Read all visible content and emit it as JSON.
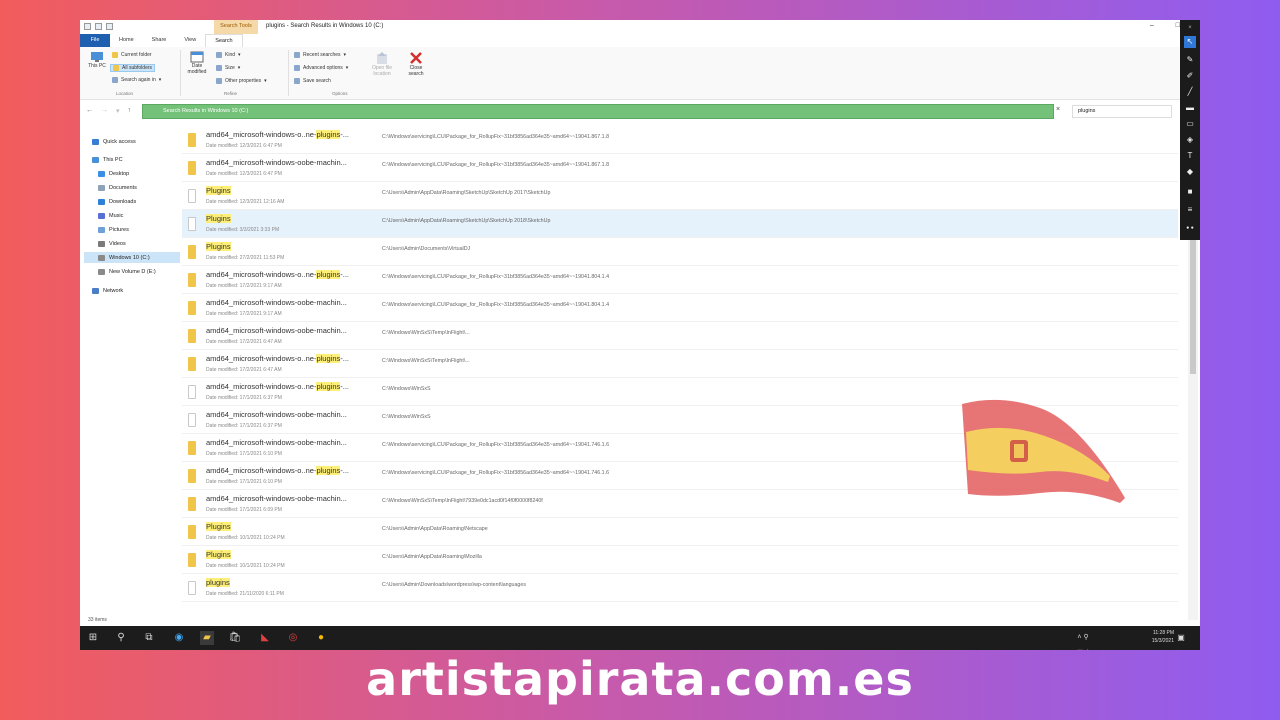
{
  "window": {
    "title": "plugins - Search Results in Windows 10 (C:)",
    "context_tab": "Search Tools"
  },
  "ribbon": {
    "tabs": [
      "File",
      "Home",
      "Share",
      "View",
      "Search"
    ],
    "location": {
      "this_pc": "This PC",
      "current_folder": "Current folder",
      "all_subfolders": "All subfolders",
      "search_again": "Search again in",
      "group": "Location"
    },
    "refine": {
      "date_modified": "Date modified",
      "kind": "Kind",
      "size": "Size",
      "other_properties": "Other properties",
      "group": "Refine"
    },
    "options": {
      "recent_searches": "Recent searches",
      "advanced_options": "Advanced options",
      "save_search": "Save search",
      "open_file_location": "Open file location",
      "close_search": "Close search",
      "group": "Options"
    }
  },
  "address": {
    "path": "Search Results in Windows 10 (C:)",
    "search_value": "plugins"
  },
  "nav": {
    "items": [
      {
        "label": "Quick access",
        "color": "#3a7bd5"
      },
      {
        "label": "This PC",
        "color": "#4a90d9"
      },
      {
        "label": "Desktop",
        "color": "#3a8ee6"
      },
      {
        "label": "Documents",
        "color": "#8fa3b8"
      },
      {
        "label": "Downloads",
        "color": "#2e7fd8"
      },
      {
        "label": "Music",
        "color": "#5a6fd6"
      },
      {
        "label": "Pictures",
        "color": "#6fa0d8"
      },
      {
        "label": "Videos",
        "color": "#7a7a7a"
      },
      {
        "label": "Windows 10 (C:)",
        "color": "#8a8a8a"
      },
      {
        "label": "New Volume D (E:)",
        "color": "#8a8a8a"
      },
      {
        "label": "Network",
        "color": "#4a7fc8"
      }
    ]
  },
  "results": [
    {
      "pre": "amd64_microsoft-windows-o..ne-",
      "hl": "plugins",
      "post": "-...",
      "date_label": "Date modified:",
      "date": "12/3/2021 6:47 PM",
      "path": "C:\\Windows\\servicing\\LCU\\Package_for_RollupFix~31bf3856ad364e35~amd64~~19041.867.1.8",
      "kind": "folder"
    },
    {
      "pre": "amd64_microsoft-windows-oobe-machin...",
      "hl": "",
      "post": "",
      "date_label": "Date modified:",
      "date": "12/3/2021 6:47 PM",
      "path": "C:\\Windows\\servicing\\LCU\\Package_for_RollupFix~31bf3856ad364e35~amd64~~19041.867.1.8",
      "kind": "folder"
    },
    {
      "pre": "",
      "hl": "Plugins",
      "post": "",
      "date_label": "Date modified:",
      "date": "12/3/2021 12:16 AM",
      "path": "C:\\Users\\Admin\\AppData\\Roaming\\SketchUp\\SketchUp 2017\\SketchUp",
      "kind": "file"
    },
    {
      "pre": "",
      "hl": "Plugins",
      "post": "",
      "date_label": "Date modified:",
      "date": "3/3/2021 3:33 PM",
      "path": "C:\\Users\\Admin\\AppData\\Roaming\\SketchUp\\SketchUp 2018\\SketchUp",
      "kind": "file"
    },
    {
      "pre": "",
      "hl": "Plugins",
      "post": "",
      "date_label": "Date modified:",
      "date": "27/2/2021 11:53 PM",
      "path": "C:\\Users\\Admin\\Documents\\VirtualDJ",
      "kind": "folder"
    },
    {
      "pre": "amd64_microsoft-windows-o..ne-",
      "hl": "plugins",
      "post": "-...",
      "date_label": "Date modified:",
      "date": "17/2/2021 9:17 AM",
      "path": "C:\\Windows\\servicing\\LCU\\Package_for_RollupFix~31bf3856ad364e35~amd64~~19041.804.1.4",
      "kind": "folder"
    },
    {
      "pre": "amd64_microsoft-windows-oobe-machin...",
      "hl": "",
      "post": "",
      "date_label": "Date modified:",
      "date": "17/2/2021 9:17 AM",
      "path": "C:\\Windows\\servicing\\LCU\\Package_for_RollupFix~31bf3856ad364e35~amd64~~19041.804.1.4",
      "kind": "folder"
    },
    {
      "pre": "amd64_microsoft-windows-oobe-machin...",
      "hl": "",
      "post": "",
      "date_label": "Date modified:",
      "date": "17/2/2021 6:47 AM",
      "path": "C:\\Windows\\WinSxS\\Temp\\InFlight\\...",
      "kind": "folder"
    },
    {
      "pre": "amd64_microsoft-windows-o..ne-",
      "hl": "plugins",
      "post": "-...",
      "date_label": "Date modified:",
      "date": "17/2/2021 6:47 AM",
      "path": "C:\\Windows\\WinSxS\\Temp\\InFlight\\...",
      "kind": "folder"
    },
    {
      "pre": "amd64_microsoft-windows-o..ne-",
      "hl": "plugins",
      "post": "-...",
      "date_label": "Date modified:",
      "date": "17/1/2021 6:37 PM",
      "path": "C:\\Windows\\WinSxS",
      "kind": "file"
    },
    {
      "pre": "amd64_microsoft-windows-oobe-machin...",
      "hl": "",
      "post": "",
      "date_label": "Date modified:",
      "date": "17/1/2021 6:37 PM",
      "path": "C:\\Windows\\WinSxS",
      "kind": "file"
    },
    {
      "pre": "amd64_microsoft-windows-oobe-machin...",
      "hl": "",
      "post": "",
      "date_label": "Date modified:",
      "date": "17/1/2021 6:10 PM",
      "path": "C:\\Windows\\servicing\\LCU\\Package_for_RollupFix~31bf3856ad364e35~amd64~~19041.746.1.6",
      "kind": "folder"
    },
    {
      "pre": "amd64_microsoft-windows-o..ne-",
      "hl": "plugins",
      "post": "-...",
      "date_label": "Date modified:",
      "date": "17/1/2021 6:10 PM",
      "path": "C:\\Windows\\servicing\\LCU\\Package_for_RollupFix~31bf3856ad364e35~amd64~~19041.746.1.6",
      "kind": "folder"
    },
    {
      "pre": "amd64_microsoft-windows-oobe-machin...",
      "hl": "",
      "post": "",
      "date_label": "Date modified:",
      "date": "17/1/2021 6:09 PM",
      "path": "C:\\Windows\\WinSxS\\Temp\\InFlight\\7939e0dc1acd0f14f0f0000f8240f",
      "kind": "folder"
    },
    {
      "pre": "",
      "hl": "Plugins",
      "post": "",
      "date_label": "Date modified:",
      "date": "10/1/2021 10:24 PM",
      "path": "C:\\Users\\Admin\\AppData\\Roaming\\Netscape",
      "kind": "folder"
    },
    {
      "pre": "",
      "hl": "Plugins",
      "post": "",
      "date_label": "Date modified:",
      "date": "10/1/2021 10:24 PM",
      "path": "C:\\Users\\Admin\\AppData\\Roaming\\Mozilla",
      "kind": "folder"
    },
    {
      "pre": "",
      "hl": "plugins",
      "post": "",
      "date_label": "Date modified:",
      "date": "21/11/2020 6:11 PM",
      "path": "C:\\Users\\Admin\\Downloads\\wordpress\\wp-content\\languages",
      "kind": "file"
    }
  ],
  "status": {
    "items_count": "33 items"
  },
  "tray": {
    "time": "11:28 PM",
    "date": "15/3/2021"
  },
  "colors": {
    "accent": "#1f5fb0",
    "address_bar": "#74c17a",
    "highlight": "#fcee76"
  },
  "watermark": "artistapirata.com.es"
}
